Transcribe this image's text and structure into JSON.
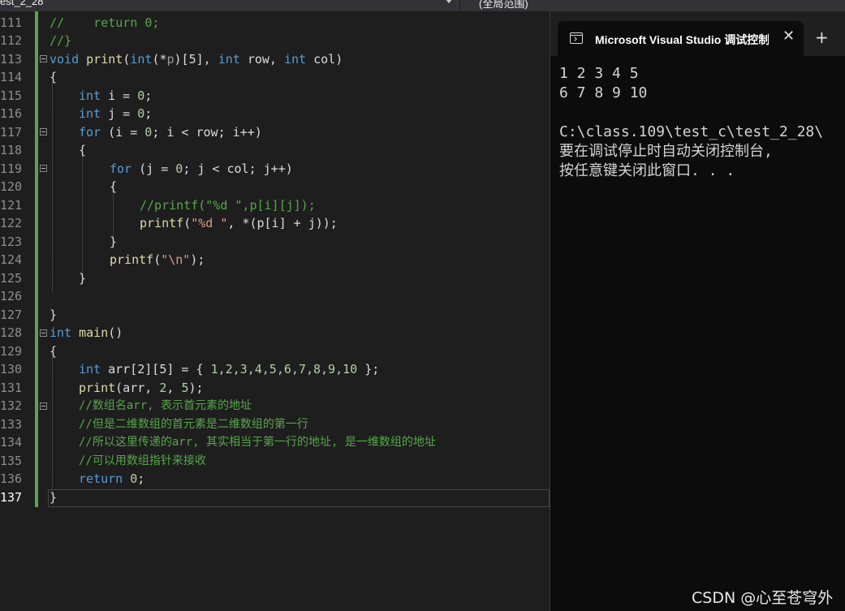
{
  "toolbar": {
    "scope_dropdown": "est_2_28",
    "member_dropdown": "(全局范围)"
  },
  "editor": {
    "line_numbers": [
      "111",
      "112",
      "113",
      "114",
      "115",
      "116",
      "117",
      "118",
      "119",
      "120",
      "121",
      "122",
      "123",
      "124",
      "125",
      "126",
      "127",
      "128",
      "129",
      "130",
      "131",
      "132",
      "133",
      "134",
      "135",
      "136",
      "137"
    ],
    "current_line": "137"
  },
  "code": {
    "l111": [
      "//    return 0;"
    ],
    "l112": [
      "//}"
    ],
    "l113": [
      "void",
      " ",
      "print",
      "(",
      "int",
      "(*",
      "p",
      ")[5], ",
      "int",
      " row, ",
      "int",
      " col)"
    ],
    "l114": [
      "{"
    ],
    "l115": [
      "int",
      " i = ",
      "0",
      ";"
    ],
    "l116": [
      "int",
      " j = ",
      "0",
      ";"
    ],
    "l117": [
      "for",
      " (i = ",
      "0",
      "; i < row; i++)"
    ],
    "l118": [
      "{"
    ],
    "l119": [
      "for",
      " (j = ",
      "0",
      "; j < col; j++)"
    ],
    "l120": [
      "{"
    ],
    "l121": [
      "//printf(\"%d \",p[i][j]);"
    ],
    "l122": [
      "printf",
      "(",
      "\"%d \"",
      ", *(p[i] + j));"
    ],
    "l123": [
      "}"
    ],
    "l124": [
      "printf",
      "(",
      "\"\\n\"",
      ");"
    ],
    "l125": [
      "}"
    ],
    "l127": [
      "}"
    ],
    "l128": [
      "int",
      " ",
      "main",
      "()"
    ],
    "l129": [
      "{"
    ],
    "l130": [
      "int",
      " arr[2][5] = { ",
      "1,2,3,4,5,6,7,8,9,10",
      " };"
    ],
    "l131": [
      "print",
      "(arr, ",
      "2",
      ", ",
      "5",
      ");"
    ],
    "l132": [
      "//数组名arr, 表示首元素的地址"
    ],
    "l133": [
      "//但是二维数组的首元素是二维数组的第一行"
    ],
    "l134": [
      "//所以这里传递的arr, 其实相当于第一行的地址, 是一维数组的地址"
    ],
    "l135": [
      "//可以用数组指针来接收"
    ],
    "l136": [
      "return",
      " ",
      "0",
      ";"
    ],
    "l137": [
      "}"
    ]
  },
  "terminal": {
    "tab_title": "Microsoft Visual Studio 调试控制台",
    "close_glyph": "✕",
    "new_tab_glyph": "+",
    "output": [
      "1 2 3 4 5",
      "6 7 8 9 10",
      "",
      "C:\\class.109\\test_c\\test_2_28\\",
      "要在调试停止时自动关闭控制台,",
      "按任意键关闭此窗口. . ."
    ]
  },
  "watermark": "CSDN @心至苍穹外",
  "colors": {
    "keyword": "#569cd6",
    "function": "#dcdcaa",
    "comment": "#57a64a",
    "string": "#d69d85",
    "number": "#b5cea8",
    "change_bar": "#57a64a",
    "terminal_bg": "#0c0c0c"
  }
}
